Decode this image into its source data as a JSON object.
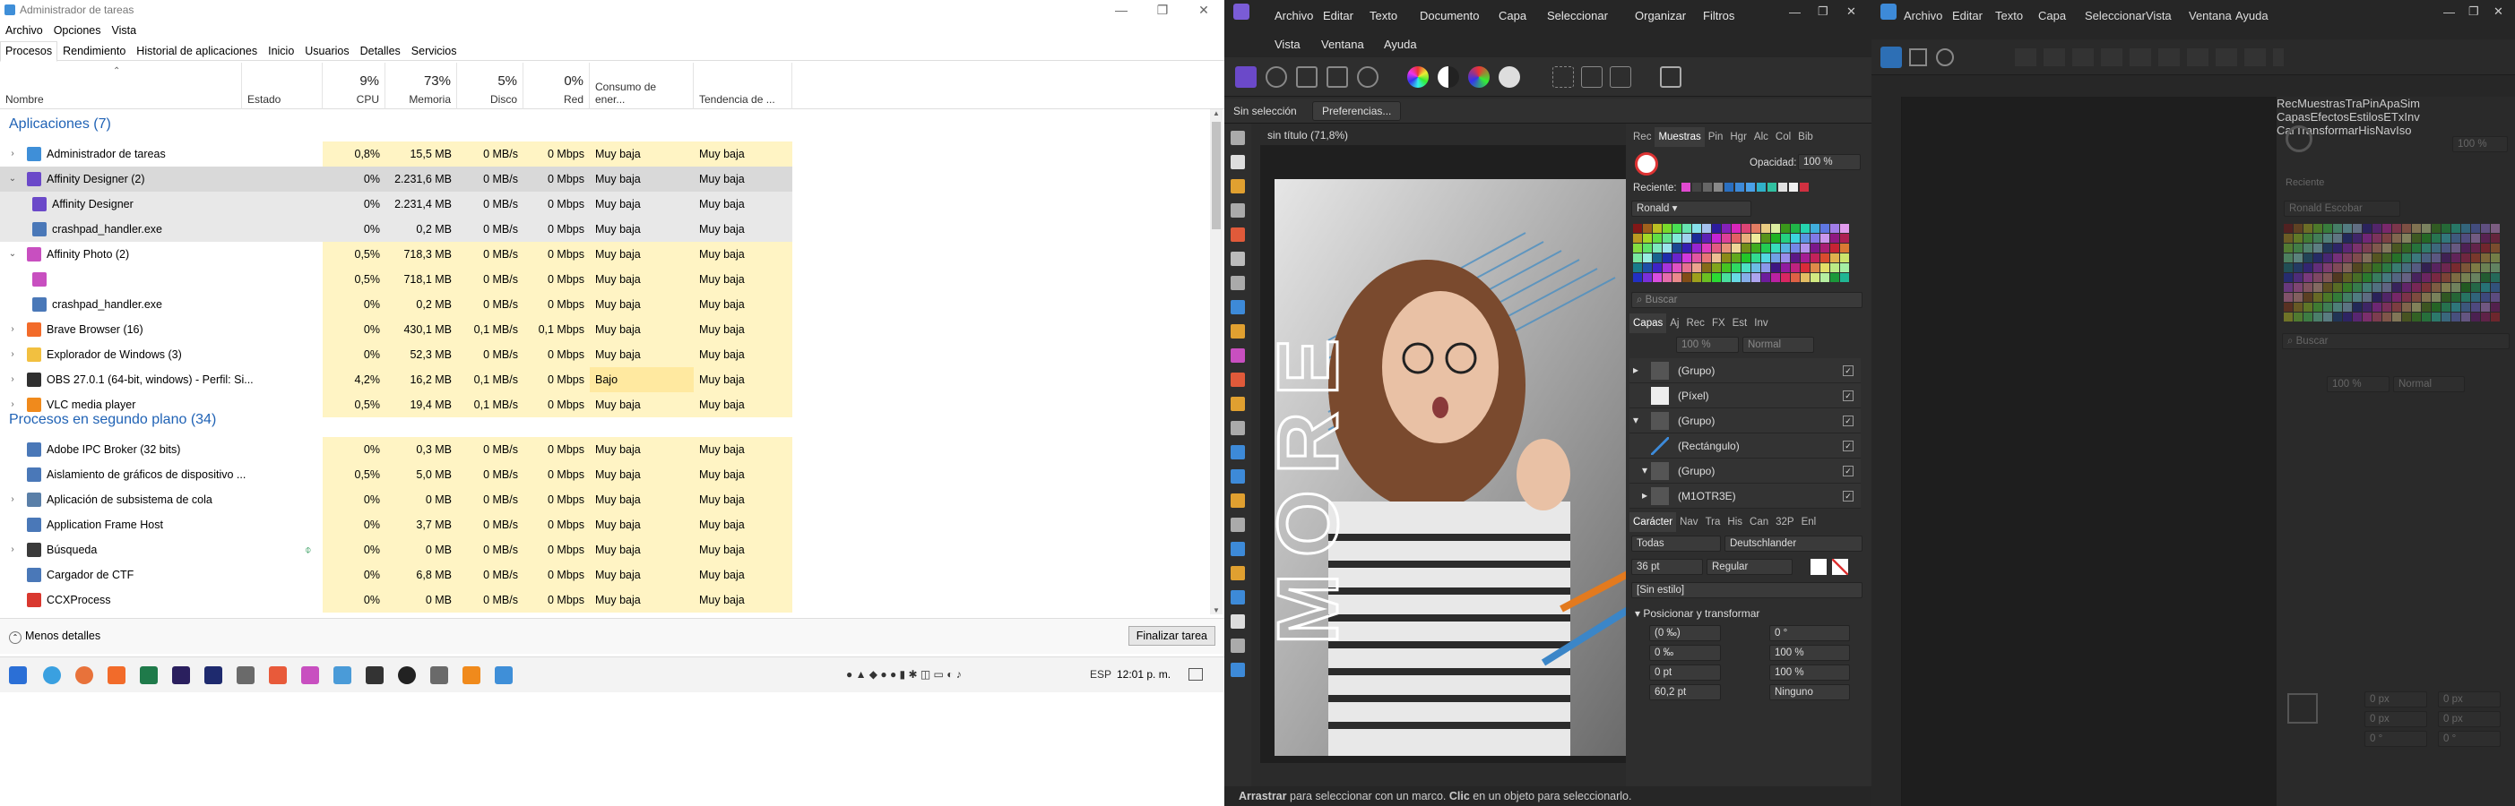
{
  "task_manager": {
    "title": "Administrador de tareas",
    "menu": [
      "Archivo",
      "Opciones",
      "Vista"
    ],
    "tabs": [
      "Procesos",
      "Rendimiento",
      "Historial de aplicaciones",
      "Inicio",
      "Usuarios",
      "Detalles",
      "Servicios"
    ],
    "active_tab": "Procesos",
    "columns": {
      "name": "Nombre",
      "status": "Estado",
      "cpu_pct": "9%",
      "cpu": "CPU",
      "mem_pct": "73%",
      "mem": "Memoria",
      "disk_pct": "5%",
      "disk": "Disco",
      "net_pct": "0%",
      "net": "Red",
      "power": "Consumo de ener...",
      "power_trend": "Tendencia de ..."
    },
    "apps_header": "Aplicaciones (7)",
    "bg_header": "Procesos en segundo plano (34)",
    "apps": [
      {
        "name": "Administrador de tareas",
        "cpu": "0,8%",
        "mem": "15,5 MB",
        "disk": "0 MB/s",
        "net": "0 Mbps",
        "power": "Muy baja",
        "trend": "Muy baja",
        "expander": "›",
        "icon": "task-manager-icon",
        "color": "#3f8fd8"
      },
      {
        "name": "Affinity Designer (2)",
        "cpu": "0%",
        "mem": "2.231,6 MB",
        "disk": "0 MB/s",
        "net": "0 Mbps",
        "power": "Muy baja",
        "trend": "Muy baja",
        "expander": "⌄",
        "icon": "affinity-designer-icon",
        "color": "#6b49c9",
        "selected": true
      },
      {
        "name": "Affinity Designer",
        "cpu": "0%",
        "mem": "2.231,4 MB",
        "disk": "0 MB/s",
        "net": "0 Mbps",
        "power": "Muy baja",
        "trend": "Muy baja",
        "child": true,
        "icon": "affinity-designer-icon",
        "color": "#6b49c9",
        "selected": true
      },
      {
        "name": "crashpad_handler.exe",
        "cpu": "0%",
        "mem": "0,2 MB",
        "disk": "0 MB/s",
        "net": "0 Mbps",
        "power": "Muy baja",
        "trend": "Muy baja",
        "child": true,
        "icon": "exe-icon",
        "color": "#4a78b8",
        "selected": true
      },
      {
        "name": "Affinity Photo (2)",
        "cpu": "0,5%",
        "mem": "718,3 MB",
        "disk": "0 MB/s",
        "net": "0 Mbps",
        "power": "Muy baja",
        "trend": "Muy baja",
        "expander": "⌄",
        "icon": "affinity-photo-icon",
        "color": "#c84fc0"
      },
      {
        "name": "",
        "cpu": "0,5%",
        "mem": "718,1 MB",
        "disk": "0 MB/s",
        "net": "0 Mbps",
        "power": "Muy baja",
        "trend": "Muy baja",
        "child": true,
        "icon": "affinity-photo-icon",
        "color": "#c84fc0"
      },
      {
        "name": "crashpad_handler.exe",
        "cpu": "0%",
        "mem": "0,2 MB",
        "disk": "0 MB/s",
        "net": "0 Mbps",
        "power": "Muy baja",
        "trend": "Muy baja",
        "child": true,
        "icon": "exe-icon",
        "color": "#4a78b8"
      },
      {
        "name": "Brave Browser (16)",
        "cpu": "0%",
        "mem": "430,1 MB",
        "disk": "0,1 MB/s",
        "net": "0,1 Mbps",
        "power": "Muy baja",
        "trend": "Muy baja",
        "expander": "›",
        "icon": "brave-icon",
        "color": "#f26b2a"
      },
      {
        "name": "Explorador de Windows (3)",
        "cpu": "0%",
        "mem": "52,3 MB",
        "disk": "0 MB/s",
        "net": "0 Mbps",
        "power": "Muy baja",
        "trend": "Muy baja",
        "expander": "›",
        "icon": "folder-icon",
        "color": "#f2c040"
      },
      {
        "name": "OBS 27.0.1 (64-bit, windows) - Perfil: Si...",
        "cpu": "4,2%",
        "mem": "16,2 MB",
        "disk": "0,1 MB/s",
        "net": "0 Mbps",
        "power": "Bajo",
        "trend": "Muy baja",
        "expander": "›",
        "icon": "obs-icon",
        "color": "#303030"
      },
      {
        "name": "VLC media player",
        "cpu": "0,5%",
        "mem": "19,4 MB",
        "disk": "0,1 MB/s",
        "net": "0 Mbps",
        "power": "Muy baja",
        "trend": "Muy baja",
        "expander": "›",
        "icon": "vlc-icon",
        "color": "#f08a1c"
      }
    ],
    "background": [
      {
        "name": "Adobe IPC Broker (32 bits)",
        "cpu": "0%",
        "mem": "0,3 MB",
        "disk": "0 MB/s",
        "net": "0 Mbps",
        "power": "Muy baja",
        "trend": "Muy baja",
        "icon": "exe-icon",
        "color": "#4a78b8"
      },
      {
        "name": "Aislamiento de gráficos de dispositivo ...",
        "cpu": "0,5%",
        "mem": "5,0 MB",
        "disk": "0 MB/s",
        "net": "0 Mbps",
        "power": "Muy baja",
        "trend": "Muy baja",
        "icon": "exe-icon",
        "color": "#4a78b8"
      },
      {
        "name": "Aplicación de subsistema de cola",
        "cpu": "0%",
        "mem": "0 MB",
        "disk": "0 MB/s",
        "net": "0 Mbps",
        "power": "Muy baja",
        "trend": "Muy baja",
        "expander": "›",
        "icon": "printer-icon",
        "color": "#5a7fa8"
      },
      {
        "name": "Application Frame Host",
        "cpu": "0%",
        "mem": "3,7 MB",
        "disk": "0 MB/s",
        "net": "0 Mbps",
        "power": "Muy baja",
        "trend": "Muy baja",
        "icon": "exe-icon",
        "color": "#4a78b8"
      },
      {
        "name": "Búsqueda",
        "cpu": "0%",
        "mem": "0 MB",
        "disk": "0 MB/s",
        "net": "0 Mbps",
        "power": "Muy baja",
        "trend": "Muy baja",
        "expander": "›",
        "icon": "search-icon",
        "color": "#3a3a3a",
        "suspended": true
      },
      {
        "name": "Cargador de CTF",
        "cpu": "0%",
        "mem": "6,8 MB",
        "disk": "0 MB/s",
        "net": "0 Mbps",
        "power": "Muy baja",
        "trend": "Muy baja",
        "icon": "ctf-icon",
        "color": "#4a78b8"
      },
      {
        "name": "CCXProcess",
        "cpu": "0%",
        "mem": "0 MB",
        "disk": "0 MB/s",
        "net": "0 Mbps",
        "power": "Muy baja",
        "trend": "Muy baja",
        "icon": "ccx-icon",
        "color": "#d9382f"
      }
    ],
    "fewer_details": "Menos detalles",
    "end_task": "Finalizar tarea"
  },
  "taskbar": {
    "language": "ESP",
    "time": "12:01 p. m."
  },
  "designer": {
    "menu_row1": [
      "Archivo",
      "Editar",
      "Texto",
      "Documento",
      "Capa",
      "Seleccionar",
      "Organizar",
      "Filtros"
    ],
    "menu_row2": [
      "Vista",
      "Ventana",
      "Ayuda"
    ],
    "context_label": "Sin selección",
    "preferences": "Preferencias...",
    "doc_title": "sin título (71,8%)",
    "canvas_text": "MORE",
    "tabs_top": [
      "Rec",
      "Muestras",
      "Pin",
      "Hgr",
      "Alc",
      "Col",
      "Bib"
    ],
    "tabs_top_active": "Muestras",
    "opacity_label": "Opacidad:",
    "opacity_value": "100 %",
    "recent_label": "Reciente:",
    "palette": "Ronald",
    "search_placeholder": "Buscar",
    "tabs_layers": [
      "Capas",
      "Aj",
      "Rec",
      "FX",
      "Est",
      "Inv"
    ],
    "layers_opacity": "100 %",
    "layers_blend": "Normal",
    "layers": [
      {
        "name": "(Grupo)",
        "exp": "▸"
      },
      {
        "name": "(Píxel)",
        "exp": ""
      },
      {
        "name": "(Grupo)",
        "exp": "▾"
      },
      {
        "name": "(Rectángulo)",
        "exp": ""
      },
      {
        "name": "(Grupo)",
        "exp": "▾"
      },
      {
        "name": "(M1OTR3E)",
        "exp": "▸"
      }
    ],
    "tabs_char": [
      "Carácter",
      "Nav",
      "Tra",
      "His",
      "Can",
      "32P",
      "Enl"
    ],
    "char_scope": "Todas",
    "char_lang": "Deutschlander",
    "font_size": "36 pt",
    "font_style": "Regular",
    "para_style": "[Sin estilo]",
    "transform_header": "Posicionar y transformar",
    "transform": [
      {
        "label": "(0 ‰)",
        "val": "0 °"
      },
      {
        "label": "0 ‰",
        "val": "100 %"
      },
      {
        "label": "0 pt",
        "val": "100 %"
      },
      {
        "label": "60,2 pt",
        "val": "Ninguno"
      }
    ],
    "status_bold1": "Arrastrar",
    "status_text1": " para seleccionar con un marco. ",
    "status_bold2": "Clic",
    "status_text2": " en un objeto para seleccionarlo."
  },
  "photo": {
    "menu": [
      "Archivo",
      "Editar",
      "Texto",
      "Capa",
      "Seleccionar",
      "Vista",
      "Ventana",
      "Ayuda"
    ],
    "tabs_top": [
      "Rec",
      "Muestras",
      "Tra",
      "Pin",
      "Apa",
      "Sim"
    ],
    "tabs_top_active": "Muestras",
    "opacity": "100 %",
    "recent": "Reciente",
    "palette": "Ronald Escobar",
    "search_placeholder": "Buscar",
    "tabs_layers": [
      "Capas",
      "Efectos",
      "Estilos",
      "ETx",
      "Inv"
    ],
    "layers_opacity": "100 %",
    "layers_blend": "Normal",
    "tabs_bottom": [
      "Car",
      "Transformar",
      "His",
      "Nav",
      "Iso"
    ],
    "tabs_bottom_active": "Transformar",
    "transform": [
      "0 px",
      "0 px",
      "0 px",
      "0 px",
      "0 °",
      "0 °"
    ]
  }
}
